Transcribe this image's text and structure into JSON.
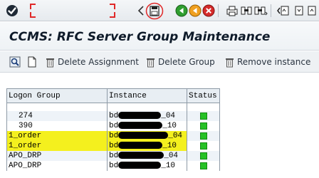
{
  "title": "CCMS: RFC Server Group Maintenance",
  "system_toolbar": {
    "icons": [
      "enter-checkmark-icon",
      "command-field",
      "collapse-arrow-icon",
      "save-icon",
      "back-icon",
      "exit-icon",
      "cancel-icon",
      "print-icon",
      "find-icon",
      "find-next-icon",
      "first-page-icon"
    ],
    "colors": {
      "back": "#2f9e2f",
      "exit": "#f0a020",
      "cancel": "#d52b2b",
      "annotation": "#e02828"
    }
  },
  "app_toolbar": {
    "buttons": [
      {
        "name": "display-button",
        "icon": "magnifier-icon",
        "label": ""
      },
      {
        "name": "create-button",
        "icon": "new-document-icon",
        "label": ""
      },
      {
        "name": "delete-assignment-button",
        "icon": "trash-icon",
        "label": "Delete Assignment"
      },
      {
        "name": "delete-group-button",
        "icon": "trash-icon",
        "label": "Delete Group"
      },
      {
        "name": "remove-instance-button",
        "icon": "trash-icon",
        "label": "Remove instance"
      }
    ]
  },
  "table": {
    "columns": [
      "Logon Group",
      "Instance",
      "Status"
    ],
    "rows": [
      {
        "group": "274",
        "instance_prefix": "bd",
        "instance_suffix": "04",
        "status": "green",
        "highlight": false
      },
      {
        "group": "390",
        "instance_prefix": "bd",
        "instance_suffix": "10",
        "status": "green",
        "highlight": false
      },
      {
        "group": "1_order",
        "instance_prefix": "bd",
        "instance_suffix": "04",
        "status": "green",
        "highlight": true
      },
      {
        "group": "1_order",
        "instance_prefix": "bd",
        "instance_suffix": "10",
        "status": "green",
        "highlight": true
      },
      {
        "group": "APO_DRP",
        "instance_prefix": "bd",
        "instance_suffix": "04",
        "status": "green",
        "highlight": false
      },
      {
        "group": "APO_DRP",
        "instance_prefix": "bd",
        "instance_suffix": "10",
        "status": "green",
        "highlight": false
      }
    ],
    "status_color": "#26c126",
    "highlight_color": "#f4f01e"
  }
}
